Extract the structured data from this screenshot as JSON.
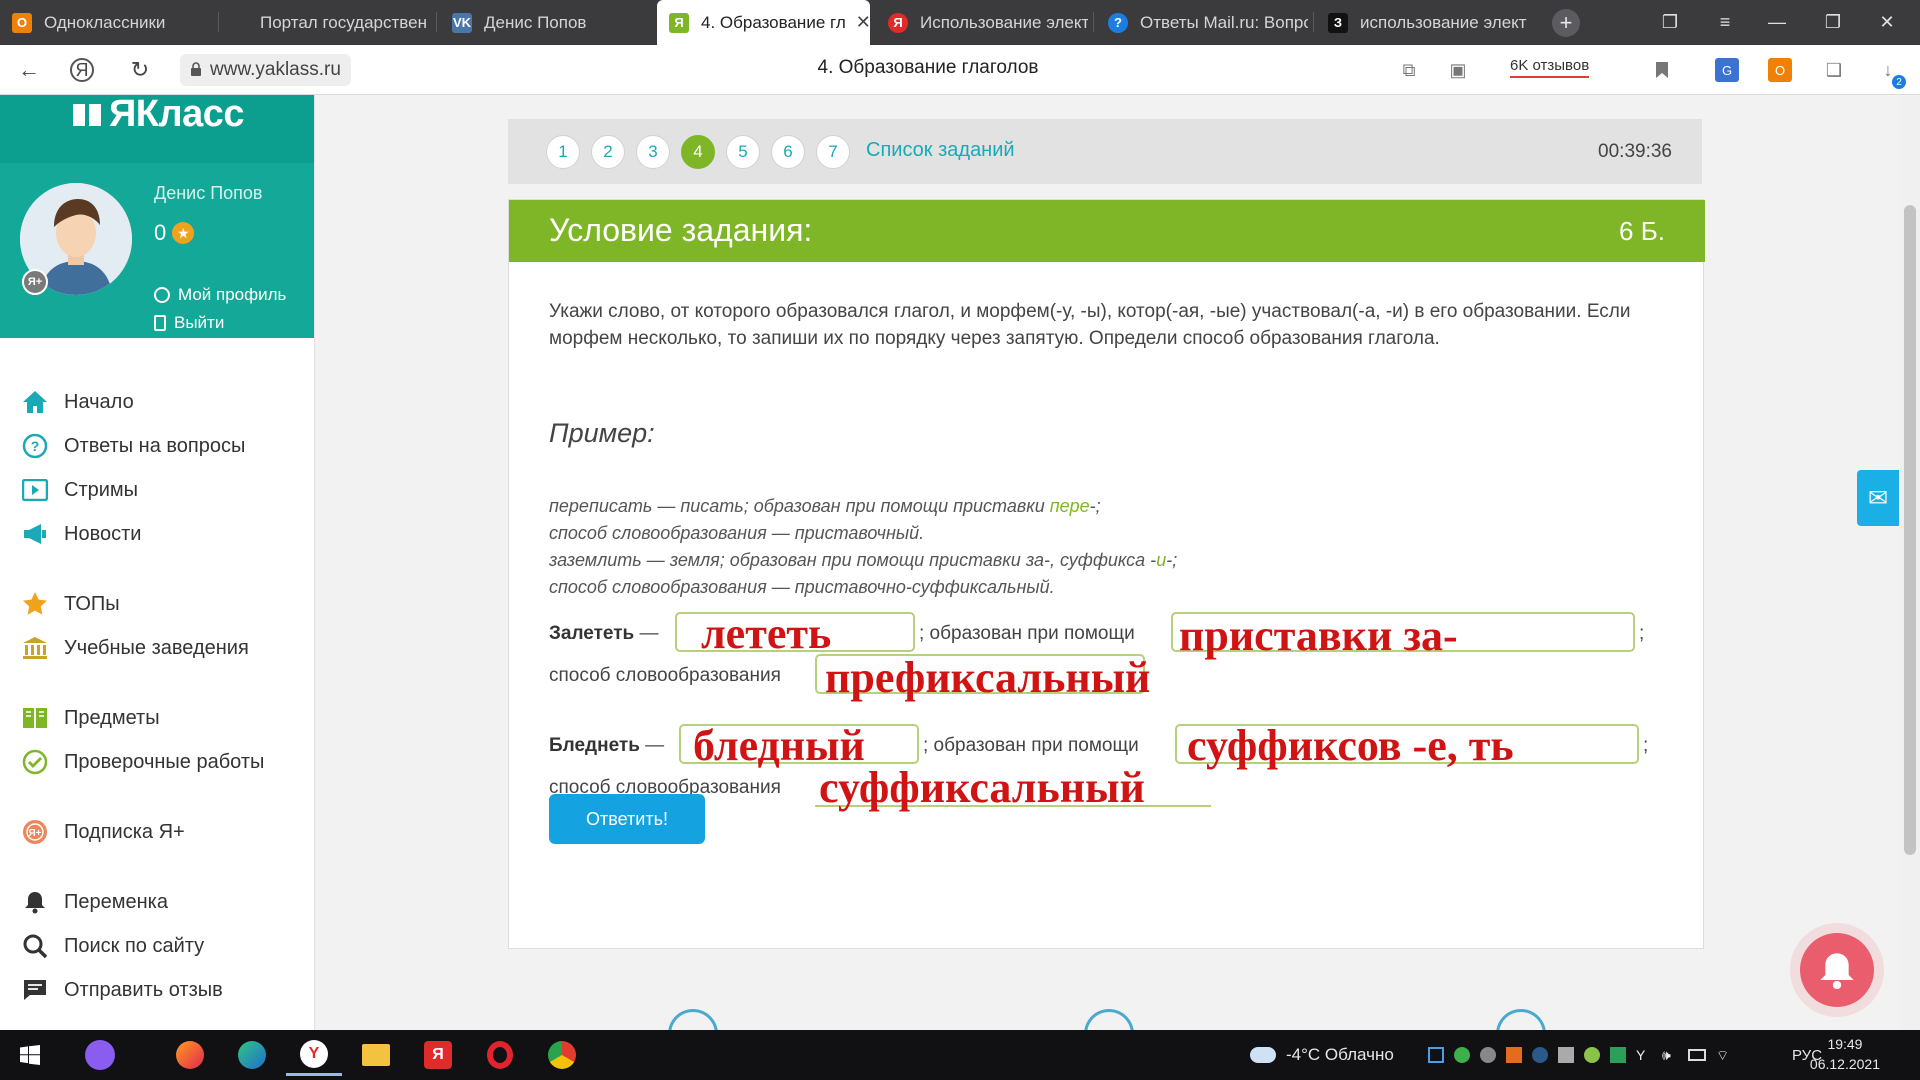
{
  "browser": {
    "tabs": [
      {
        "title": "Одноклассники",
        "icon": "ok-icon",
        "color": "#ee8208"
      },
      {
        "title": "Портал государственн",
        "icon": "gov-icon",
        "color": "#3b3b3e"
      },
      {
        "title": "Денис Попов",
        "icon": "vk-icon",
        "color": "#4a76a8"
      },
      {
        "title": "4. Образование гл",
        "icon": "yaklass-icon",
        "color": "#7fb627"
      },
      {
        "title": "Использование элект",
        "icon": "yandex-icon",
        "color": "#e02b2b"
      },
      {
        "title": "Ответы Mail.ru: Вопро",
        "icon": "mailru-icon",
        "color": "#1c7ee3"
      },
      {
        "title": "использование элект",
        "icon": "zen-icon",
        "color": "#111111"
      }
    ],
    "new_tab": "+",
    "url": "www.yaklass.ru",
    "page_title": "4. Образование глаголов",
    "reviews": "6K отзывов",
    "downloads_badge": "2"
  },
  "sidebar": {
    "logo": "ЯКласс",
    "user": {
      "name": "Денис Попов",
      "points": "0",
      "badge": "Я+",
      "profile": "Мой профиль",
      "logout": "Выйти"
    },
    "menu": [
      {
        "label": "Начало",
        "icon": "home-icon"
      },
      {
        "label": "Ответы на вопросы",
        "icon": "question-icon"
      },
      {
        "label": "Стримы",
        "icon": "stream-icon"
      },
      {
        "label": "Новости",
        "icon": "news-icon"
      },
      {
        "label": "ТОПы",
        "icon": "star-icon"
      },
      {
        "label": "Учебные заведения",
        "icon": "school-icon"
      },
      {
        "label": "Предметы",
        "icon": "book-icon"
      },
      {
        "label": "Проверочные работы",
        "icon": "check-icon"
      },
      {
        "label": "Подписка Я+",
        "icon": "subscription-icon"
      },
      {
        "label": "Переменка",
        "icon": "bell-icon"
      },
      {
        "label": "Поиск по сайту",
        "icon": "search-icon"
      },
      {
        "label": "Отправить отзыв",
        "icon": "feedback-icon"
      }
    ]
  },
  "tasknav": {
    "steps": [
      "1",
      "2",
      "3",
      "4",
      "5",
      "6",
      "7"
    ],
    "active_step": "4",
    "list_label": "Список заданий",
    "timer": "00:39:36"
  },
  "task": {
    "header": "Условие задания:",
    "points": "6 Б.",
    "instruction": "Укажи слово, от которого образовался глагол, и морфем(-у, -ы), котор(-ая, -ые) участвовал(-а, -и) в его образовании. Если морфем несколько, то запиши их по порядку через запятую. Определи способ образования глагола.",
    "example_title": "Пример:",
    "example": {
      "l1_a": "переписать — писать; образован при помощи приставки ",
      "l1_b": "пере",
      "l1_c": "-;",
      "l2": "способ словообразования — приставочный.",
      "l3_a": "заземлить — земля; образован при помощи приставки за-, суффикса -",
      "l3_b": "и",
      "l3_c": "-;",
      "l4": "способ словообразования — приставочно-суффиксальный."
    },
    "q1": {
      "word": "Залететь",
      "dash": "—",
      "mid": "; образован при помощи",
      "end": ";",
      "method": "способ словообразования",
      "ans_source": "лететь",
      "ans_morph": "приставки за-",
      "ans_method": "префиксальный"
    },
    "q2": {
      "word": "Бледнеть",
      "dash": "—",
      "mid": "; образован при помощи",
      "end": ";",
      "method": "способ словообразования",
      "ans_source": "бледный",
      "ans_morph": "суффиксов -е, ть",
      "ans_method": "суффиксальный"
    },
    "submit": "Ответить!"
  },
  "taskbar": {
    "weather": "-4°C Облачно",
    "lang": "РУС",
    "time": "19:49",
    "date": "06.12.2021"
  }
}
